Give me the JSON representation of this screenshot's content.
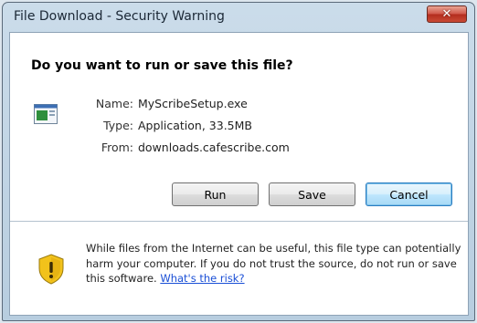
{
  "window": {
    "title": "File Download - Security Warning"
  },
  "icons": {
    "close": "close-icon",
    "file": "application-file-icon",
    "shield": "warning-shield-icon"
  },
  "dialog": {
    "question": "Do you want to run or save this file?",
    "details": {
      "name_label": "Name:",
      "name_value": "MyScribeSetup.exe",
      "type_label": "Type:",
      "type_value": "Application, 33.5MB",
      "from_label": "From:",
      "from_value": "downloads.cafescribe.com"
    },
    "buttons": {
      "run": "Run",
      "save": "Save",
      "cancel": "Cancel"
    },
    "warning": {
      "text": "While files from the Internet can be useful, this file type can potentially harm your computer. If you do not trust the source, do not run or save this software.",
      "link": "What's the risk?"
    }
  },
  "colors": {
    "close_button": "#c94a35",
    "link": "#1a4fd6",
    "shield_yellow": "#f2c21b"
  }
}
